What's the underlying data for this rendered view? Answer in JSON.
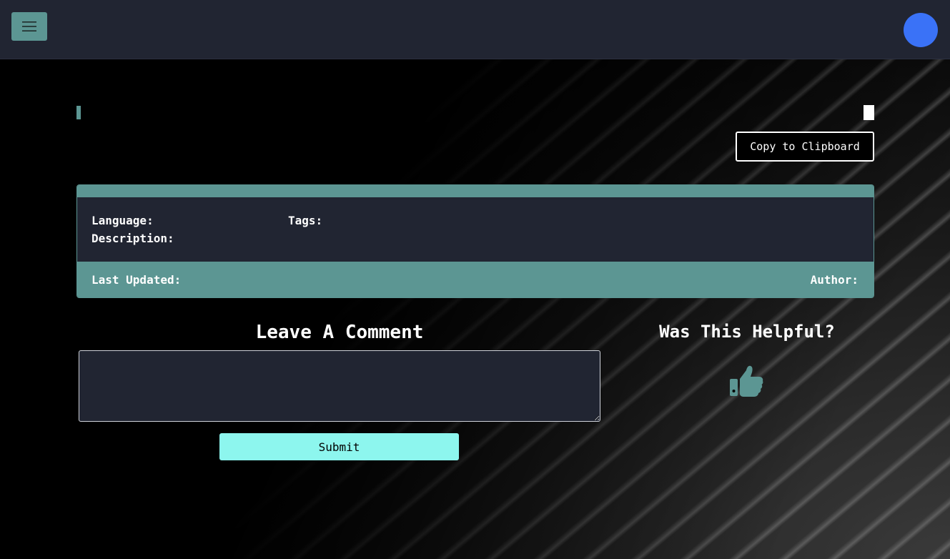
{
  "header": {
    "menu_icon": "hamburger-icon",
    "avatar_color": "#3a72f7"
  },
  "snippet": {
    "title": "",
    "copy_icon": "copy-icon",
    "copy_button_label": "Copy to Clipboard"
  },
  "meta": {
    "language_label": "Language:",
    "tags_label": "Tags:",
    "description_label": "Description:",
    "last_updated_label": "Last Updated:",
    "author_label": "Author:"
  },
  "comment": {
    "title": "Leave A Comment",
    "value": "",
    "submit_label": "Submit"
  },
  "feedback": {
    "title": "Was This Helpful?",
    "icon": "thumbs-up-icon"
  },
  "colors": {
    "accent": "#5c9693",
    "panel": "#212532",
    "submit": "#8df6ee"
  }
}
